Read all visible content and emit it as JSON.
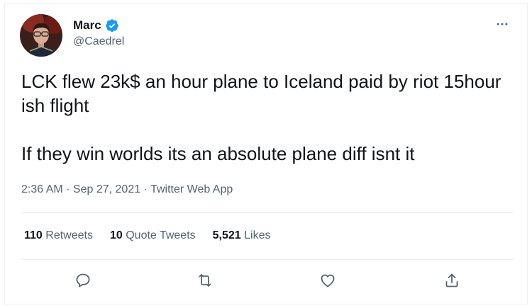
{
  "tweet": {
    "author_name": "Marc",
    "author_handle": "@Caedrel",
    "verified": true,
    "text_line1": "LCK flew 23k$ an hour plane to Iceland paid by riot 15hour ish flight",
    "text_line2": "If they win worlds its an absolute plane diff isnt it",
    "time": "2:36 AM",
    "date": "Sep 27, 2021",
    "source": "Twitter Web App",
    "separator": " · "
  },
  "stats": {
    "retweets_count": "110",
    "retweets_label": "Retweets",
    "quotes_count": "10",
    "quotes_label": "Quote Tweets",
    "likes_count": "5,521",
    "likes_label": "Likes"
  },
  "icons": {
    "more": "more-horizontal-icon",
    "reply": "reply-icon",
    "retweet": "retweet-icon",
    "like": "like-icon",
    "share": "share-icon",
    "verified": "verified-badge-icon"
  },
  "colors": {
    "accent": "#1d9bf0",
    "muted": "#536471",
    "text": "#0f1419"
  }
}
